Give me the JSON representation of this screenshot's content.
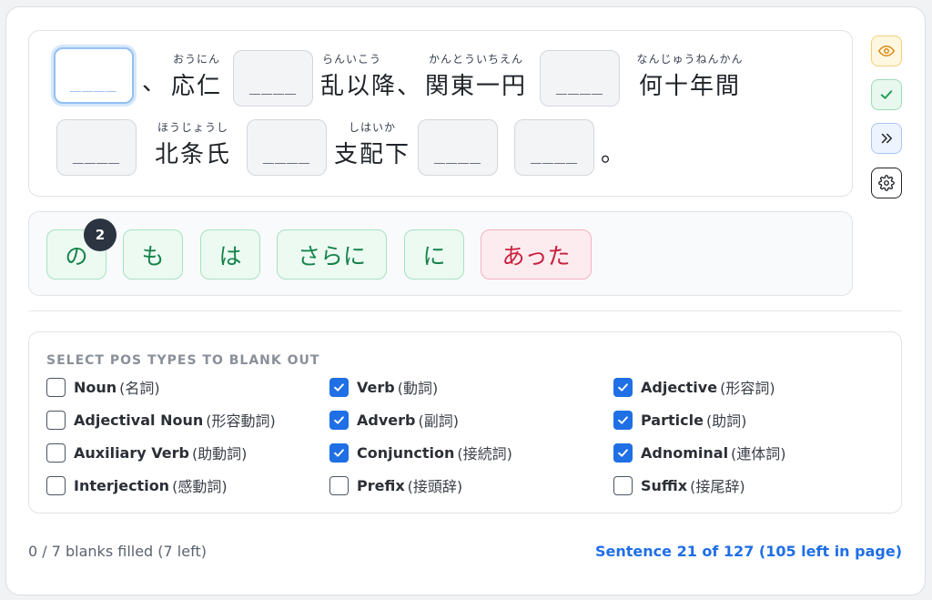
{
  "sentence": {
    "blank_text": "____",
    "comma": "、",
    "period": "。",
    "words": [
      {
        "ruby": "おうにん",
        "base": "応仁"
      },
      {
        "ruby": "らんいこう",
        "base": "乱以降、"
      },
      {
        "ruby": "かんとういちえん",
        "base": "関東一円"
      },
      {
        "ruby": "なんじゅうねんかん",
        "base": "何十年間"
      },
      {
        "ruby": "ほうじょうし",
        "base": "北条氏"
      },
      {
        "ruby": "しはいか",
        "base": "支配下"
      }
    ]
  },
  "side_buttons": {
    "reveal": "eye-icon",
    "check": "check-icon",
    "skip": "double-chevron-right-icon",
    "settings": "gear-icon"
  },
  "word_bank": {
    "chips": [
      "の",
      "も",
      "は",
      "さらに",
      "に",
      "あった"
    ],
    "badge_count": "2"
  },
  "pos": {
    "title": "SELECT POS TYPES TO BLANK OUT",
    "items": [
      {
        "label": "Noun",
        "jp": "(名詞)",
        "checked": false
      },
      {
        "label": "Verb",
        "jp": "(動詞)",
        "checked": true
      },
      {
        "label": "Adjective",
        "jp": "(形容詞)",
        "checked": true
      },
      {
        "label": "Adjectival Noun",
        "jp": "(形容動詞)",
        "checked": false
      },
      {
        "label": "Adverb",
        "jp": "(副詞)",
        "checked": true
      },
      {
        "label": "Particle",
        "jp": "(助詞)",
        "checked": true
      },
      {
        "label": "Auxiliary Verb",
        "jp": "(助動詞)",
        "checked": false
      },
      {
        "label": "Conjunction",
        "jp": "(接続詞)",
        "checked": true
      },
      {
        "label": "Adnominal",
        "jp": "(連体詞)",
        "checked": true
      },
      {
        "label": "Interjection",
        "jp": "(感動詞)",
        "checked": false
      },
      {
        "label": "Prefix",
        "jp": "(接頭辞)",
        "checked": false
      },
      {
        "label": "Suffix",
        "jp": "(接尾辞)",
        "checked": false
      }
    ]
  },
  "footer": {
    "progress": "0 / 7 blanks filled (7 left)",
    "sentence_nav": "Sentence 21 of 127 (105 left in page)"
  },
  "colors": {
    "accent": "#1f6fe5",
    "chip_green": "#16834b",
    "chip_red": "#c8203f"
  }
}
